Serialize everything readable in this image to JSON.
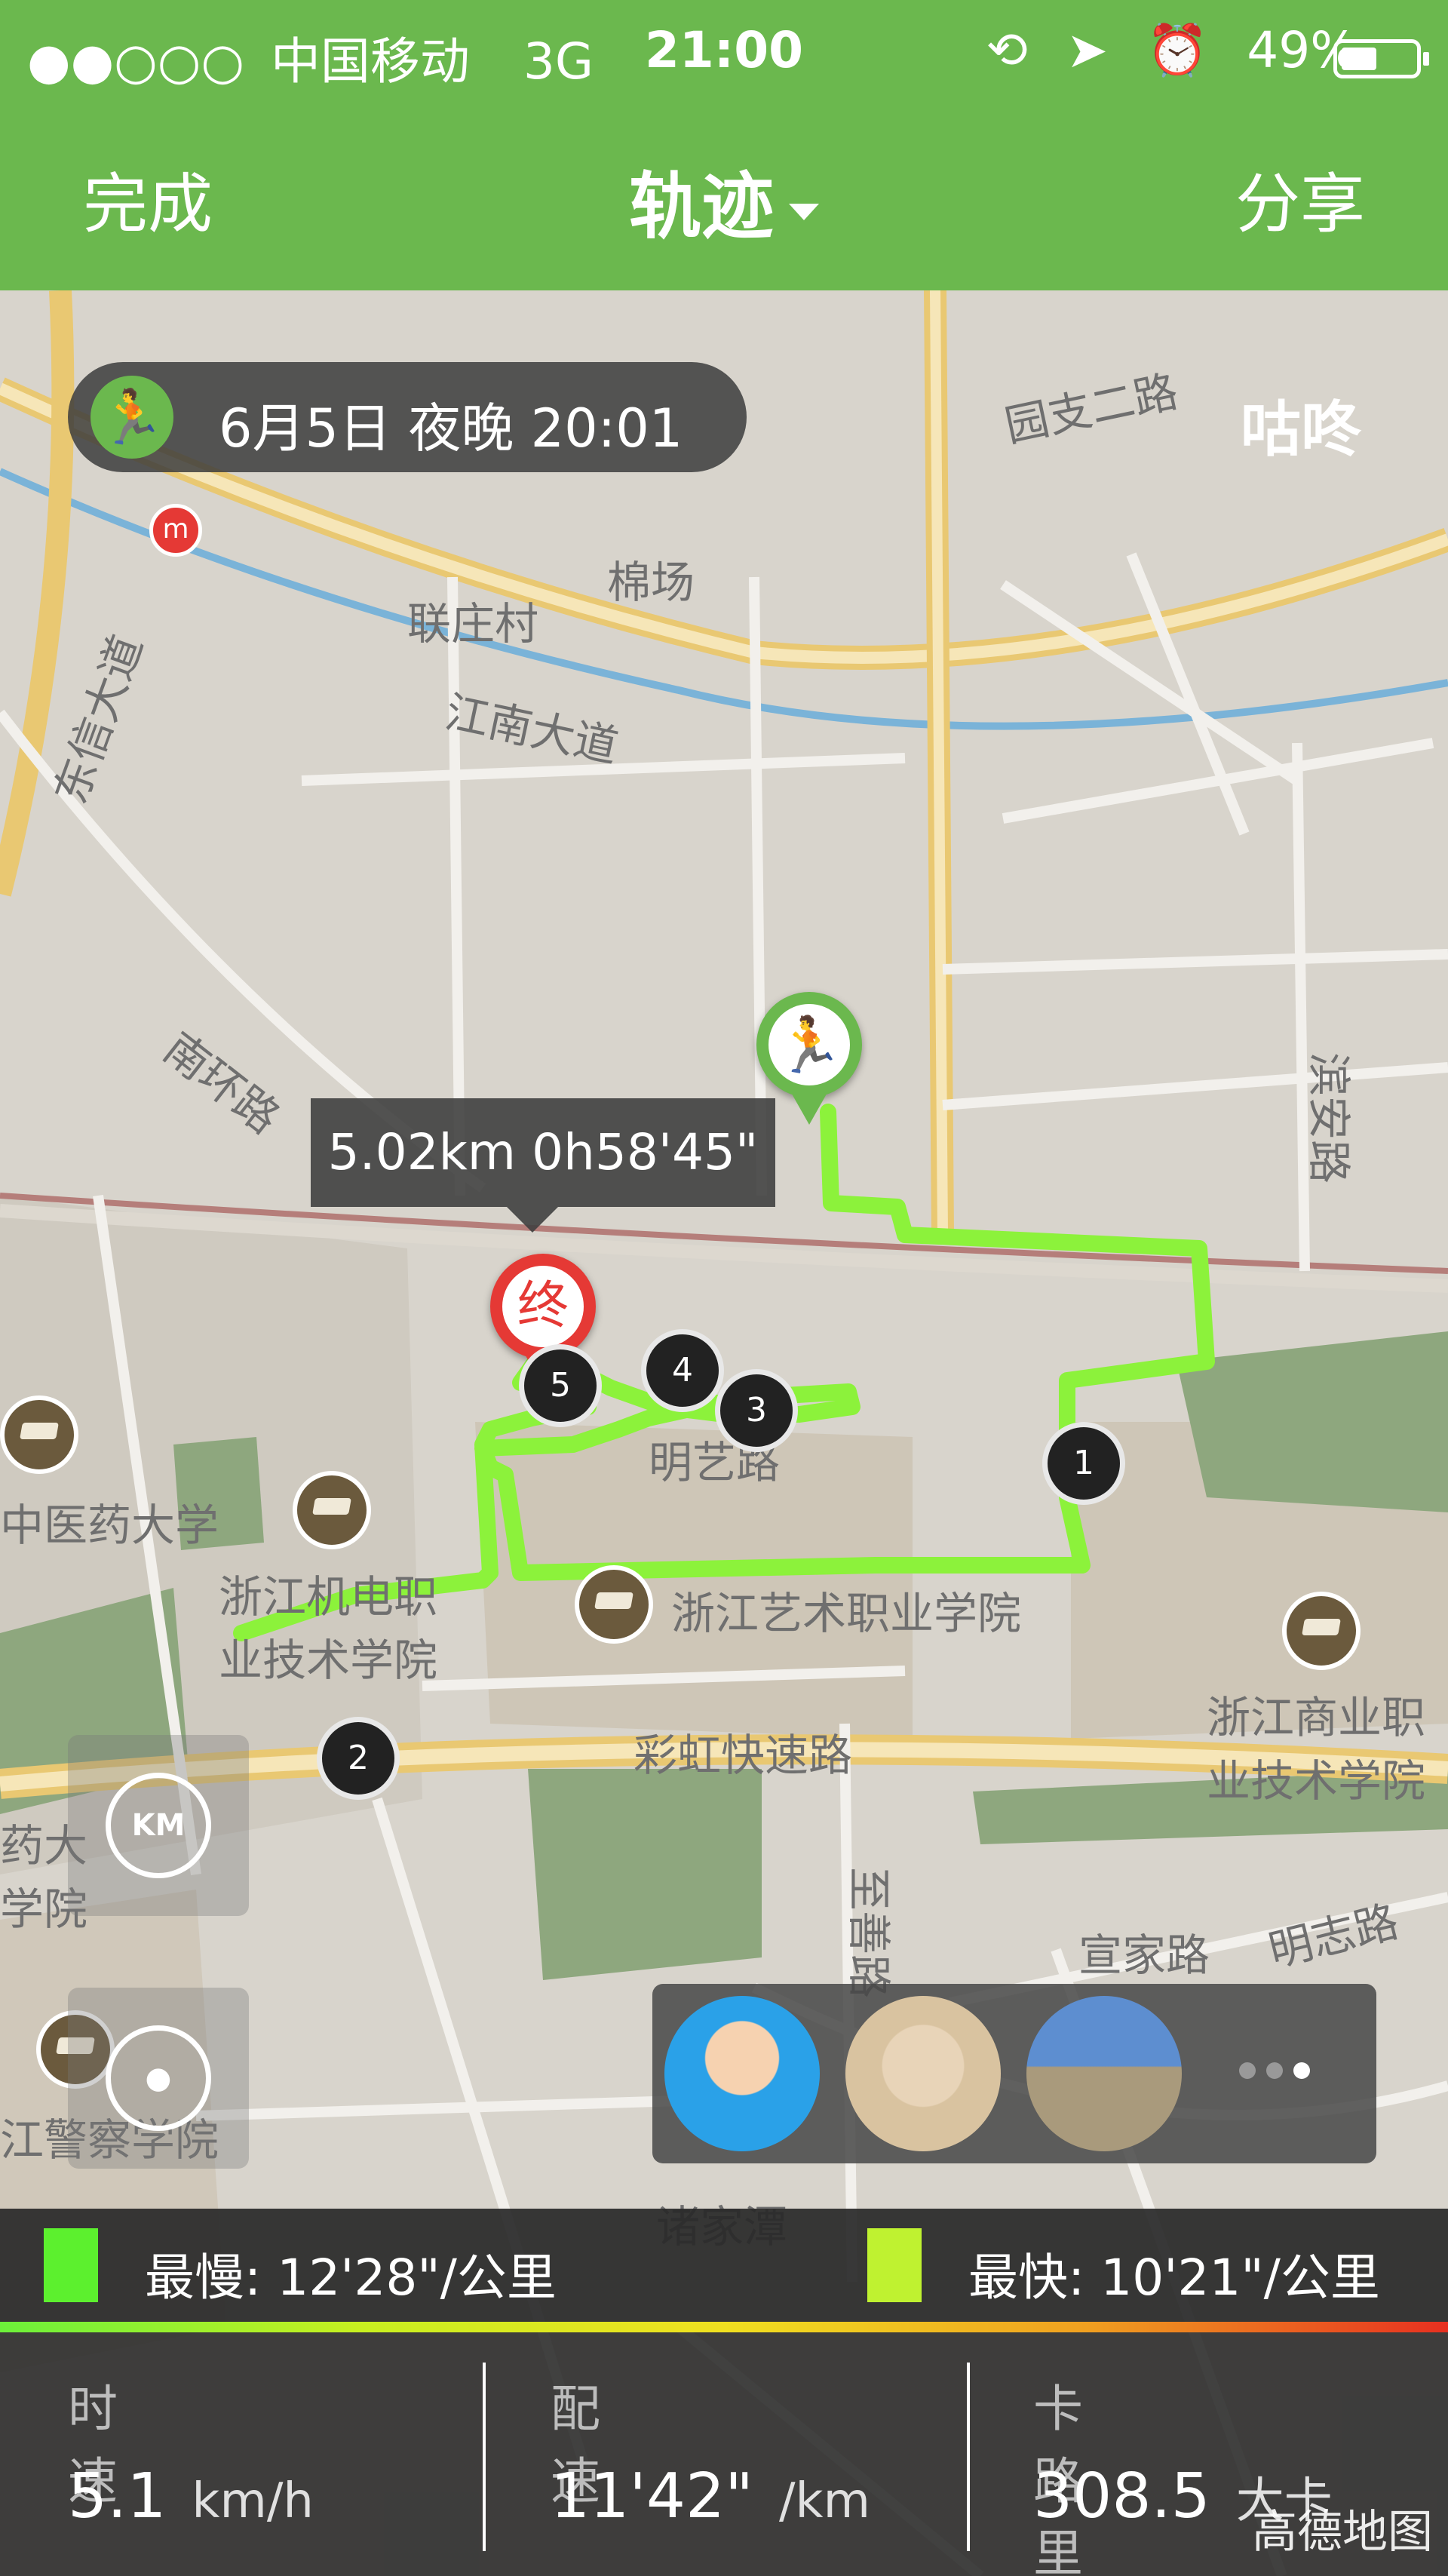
{
  "status_bar": {
    "signal": "●●○○○",
    "carrier": "中国移动",
    "network": "3G",
    "time": "21:00",
    "battery_text": "49%",
    "battery_level": 0.49
  },
  "nav": {
    "left": "完成",
    "title": "轨迹",
    "right": "分享"
  },
  "activity": {
    "date": "6月5日 夜晚 20:01",
    "brand": "咕咚"
  },
  "tooltip": "5.02km 0h58'45\"",
  "end_marker": "终",
  "splits": [
    "1",
    "2",
    "3",
    "4",
    "5"
  ],
  "map_labels": {
    "yuanzhi": "园支二路",
    "mianchang": "棉场",
    "lianzhuang": "联庄村",
    "jiangnan": "江南大道",
    "dongxin": "东信大道",
    "nanhuan": "南环路",
    "binan": "滨安路",
    "mingyi": "明艺路",
    "zjart": "浙江艺术职业学院",
    "zjjd": "浙江机电职\n业技术学院",
    "zyyd": "中医药大学",
    "zjsy": "浙江商业职\n业技术学院",
    "caihong": "彩虹快速路",
    "zhishan": "至善路",
    "xuanjia": "宣家路",
    "mingzhi": "明志路",
    "zhujiatan": "诸家潭",
    "yaoda": "药大\n学院",
    "jingcha": "江警察学院"
  },
  "km_button": "KM",
  "legend": {
    "slowest": "最慢: 12'28\"/公里",
    "fastest": "最快: 10'21\"/公里",
    "slow_color": "#5cf02e",
    "fast_color": "#bff230"
  },
  "stats": [
    {
      "label": "时速",
      "value": "5.1",
      "unit": "km/h"
    },
    {
      "label": "配速",
      "value": "11'42\"",
      "unit": "/km"
    },
    {
      "label": "卡路里",
      "value": "308.5",
      "unit": "大卡"
    }
  ],
  "watermark": "高德地图",
  "colors": {
    "accent": "#6bb84e",
    "track": "#8cf23b",
    "end_pin": "#e53935"
  }
}
